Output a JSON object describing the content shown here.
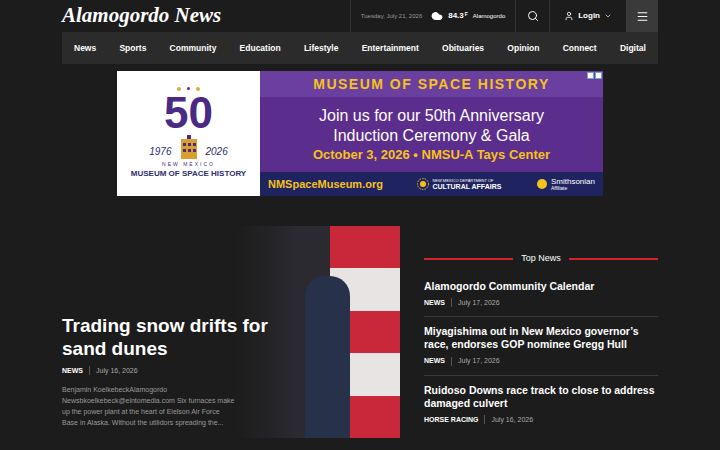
{
  "header": {
    "logo": "Alamogordo News",
    "date": "Tuesday, July 21, 2026",
    "temperature": "84.3",
    "unit": "F",
    "city": "Alamogordo",
    "login": "Login"
  },
  "nav": [
    "News",
    "Sports",
    "Community",
    "Education",
    "Lifestyle",
    "Entertainment",
    "Obituaries",
    "Opinion",
    "Connect",
    "Digital"
  ],
  "ad": {
    "logo_number": "50",
    "logo_start_year": "1976",
    "logo_end_year": "2026",
    "logo_state": "NEW MEXICO",
    "logo_name": "MUSEUM OF SPACE HISTORY",
    "headline": "MUSEUM OF SPACE HISTORY",
    "line1": "Join us for our 50th Anniversary",
    "line2": "Induction Ceremony & Gala",
    "date_line": "October 3, 2026 • NMSU-A Tays Center",
    "website": "NMSpaceMuseum.org",
    "partner1_top": "NEW MEXICO DEPARTMENT OF",
    "partner1_bottom": "CULTURAL AFFAIRS",
    "partner2_top": "Smithsonian",
    "partner2_bottom": "Affiliate"
  },
  "feature": {
    "title": "Trading snow drifts for sand dunes",
    "category": "NEWS",
    "date": "July 16, 2026",
    "excerpt": "Benjamin KoelkebeckAlamogordo Newsbkoelkebeck@elntomedia.com Six furnaces make up the power plant at the heart of Eielson Air Force Base in Alaska. Without the utilidors spreading the..."
  },
  "top_news": {
    "title": "Top News",
    "items": [
      {
        "title": "Alamogordo Community Calendar",
        "category": "NEWS",
        "date": "July 17, 2026"
      },
      {
        "title": "Miyagishima out in New Mexico governor’s race, endorses GOP nominee Gregg Hull",
        "category": "NEWS",
        "date": "July 17, 2026"
      },
      {
        "title": "Ruidoso Downs race track to close to address damaged culvert",
        "category": "HORSE RACING",
        "date": "July 16, 2026"
      }
    ]
  }
}
